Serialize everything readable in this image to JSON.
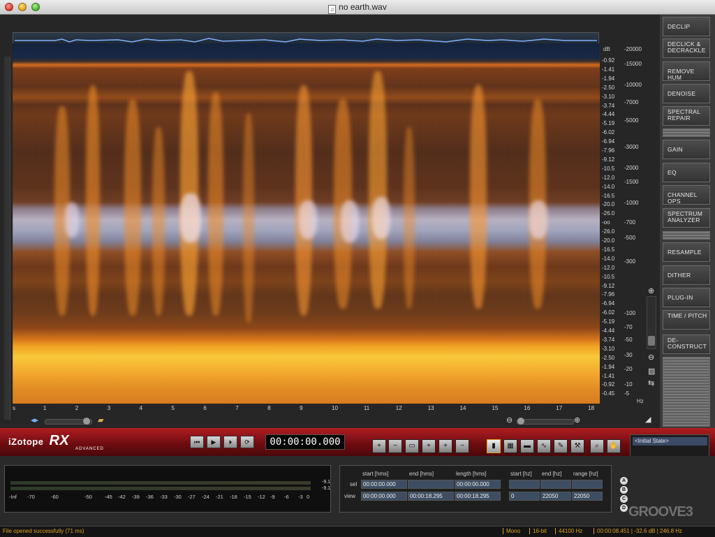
{
  "window": {
    "title": "no earth.wav",
    "buttons": [
      "close",
      "minimize",
      "zoom"
    ]
  },
  "spectrogram": {
    "db_unit": "dB",
    "hz_unit": "Hz",
    "db_ticks": [
      "-0.92",
      "-1.41",
      "-1.94",
      "-2.50",
      "-3.10",
      "-3.74",
      "-4.44",
      "-5.19",
      "-6.02",
      "-6.94",
      "-7.96",
      "-9.12",
      "-10.5",
      "-12.0",
      "-14.0",
      "-16.5",
      "-20.0",
      "-26.0",
      "-oo",
      "-26.0",
      "-20.0",
      "-16.5",
      "-14.0",
      "-12.0",
      "-10.5",
      "-9.12",
      "-7.96",
      "-6.94",
      "-6.02",
      "-5.19",
      "-4.44",
      "-3.74",
      "-3.10",
      "-2.50",
      "-1.94",
      "-1.41",
      "-0.92",
      "-0.45"
    ],
    "hz_ticks": [
      "-20000",
      "-15000",
      "-10000",
      "-7000",
      "-5000",
      "-3000",
      "-2000",
      "-1500",
      "-1000",
      "-700",
      "-500",
      "-300",
      "-100",
      "-70",
      "-50",
      "-30",
      "-20",
      "-10",
      "-5"
    ],
    "time_ticks": [
      "s",
      "1",
      "2",
      "3",
      "4",
      "5",
      "6",
      "7",
      "8",
      "9",
      "10",
      "11",
      "12",
      "13",
      "14",
      "15",
      "16",
      "17",
      "18"
    ]
  },
  "modules": [
    "DECLIP",
    "DECLICK & DECRACKLE",
    "REMOVE HUM",
    "DENOISE",
    "SPECTRAL REPAIR",
    "GAIN",
    "EQ",
    "CHANNEL OPS",
    "SPECTRUM ANALYZER",
    "RESAMPLE",
    "DITHER",
    "PLUG-IN",
    "TIME / PITCH",
    "DE-CONSTRUCT"
  ],
  "branding": {
    "company": "iZotope",
    "product": "RX",
    "edition": "ADVANCED",
    "watermark": "GROOVE3"
  },
  "transport": {
    "timecode": "00:00:00.000",
    "buttons": [
      {
        "name": "return-to-start-button",
        "icon": "⏮"
      },
      {
        "name": "play-button",
        "icon": "▶"
      },
      {
        "name": "play-selection-button",
        "icon": "⏵"
      },
      {
        "name": "loop-button",
        "icon": "⟳"
      }
    ]
  },
  "tools": [
    {
      "name": "zoom-in-tool",
      "icon": "+"
    },
    {
      "name": "zoom-out-tool",
      "icon": "−"
    },
    {
      "name": "zoom-selection-tool",
      "icon": "▭"
    },
    {
      "name": "zoom-time-in-tool",
      "icon": "+"
    },
    {
      "name": "zoom-freq-tool",
      "icon": "+"
    },
    {
      "name": "zoom-fit-tool",
      "icon": "−"
    },
    {
      "name": "time-selection-tool",
      "icon": "▮"
    },
    {
      "name": "rect-selection-tool",
      "icon": "▦"
    },
    {
      "name": "freq-selection-tool",
      "icon": "▬"
    },
    {
      "name": "lasso-tool",
      "icon": "∿"
    },
    {
      "name": "brush-tool",
      "icon": "✎"
    },
    {
      "name": "magic-wand-tool",
      "icon": "⚒"
    },
    {
      "name": "magnifier-tool",
      "icon": "⌕"
    },
    {
      "name": "hand-tool",
      "icon": "✋"
    }
  ],
  "meter": {
    "scale": [
      "-Inf",
      "-70",
      "-60",
      "-50",
      "-45",
      "-42",
      "-39",
      "-36",
      "-33",
      "-30",
      "-27",
      "-24",
      "-21",
      "-18",
      "-15",
      "-12",
      "-9",
      "-6",
      "-3",
      "0"
    ],
    "peak_values": [
      "-9.1",
      "-9.1"
    ]
  },
  "selection_panel": {
    "headers": [
      "start [hms]",
      "end [hms]",
      "length [hms]",
      "start [hz]",
      "end [hz]",
      "range [hz]"
    ],
    "rows": [
      {
        "label": "sel",
        "values": [
          "00:00:00.000",
          "",
          "00:00:00.000",
          "",
          "",
          ""
        ]
      },
      {
        "label": "view",
        "values": [
          "00:00:00.000",
          "00:00:18.295",
          "00:00:18.295",
          "0",
          "22050",
          "22050"
        ]
      }
    ]
  },
  "history": {
    "items": [
      "<Initial State>"
    ]
  },
  "compare_buttons": [
    "A",
    "B",
    "C",
    "D"
  ],
  "status": {
    "message": "File opened successfully (71 ms)",
    "fields": [
      "Mono",
      "16-bit",
      "44100 Hz",
      "00:00:08.451 | -32.6 dB | 246.8 Hz"
    ]
  }
}
